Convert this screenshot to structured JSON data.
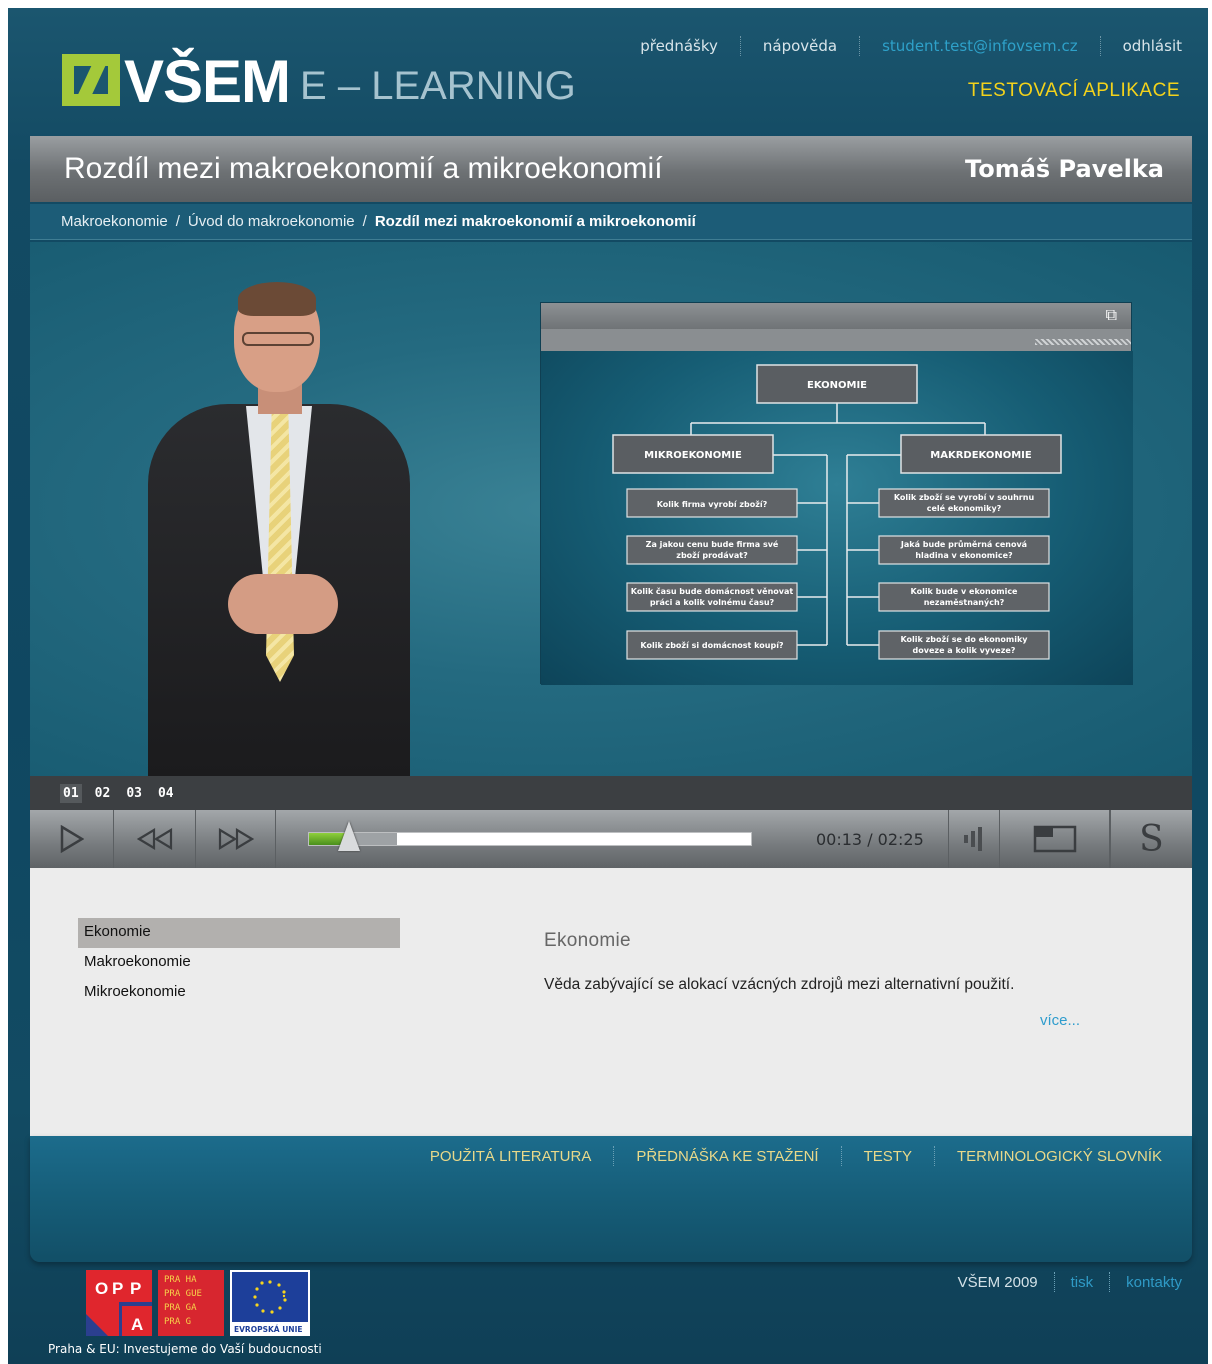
{
  "header": {
    "logo_text": "VŠEM",
    "logo_sub": "E – LEARNING",
    "nav": [
      "přednášky",
      "nápověda",
      "student.test@infovsem.cz",
      "odhlásit"
    ],
    "app_label": "TESTOVACÍ APLIKACE"
  },
  "lesson": {
    "title": "Rozdíl mezi makroekonomií a mikroekonomií",
    "author": "Tomáš Pavelka",
    "breadcrumb": [
      "Makroekonomie",
      "Úvod do makroekonomie",
      "Rozdíl mezi makroekonomií a mikroekonomií"
    ]
  },
  "slide": {
    "root": "EKONOMIE",
    "left_title": "MIKROEKONOMIE",
    "right_title": "MAKRDEKONOMIE",
    "left_items": [
      [
        "Kolik firma vyrobí zboží?"
      ],
      [
        "Za jakou cenu bude firma své",
        "zboží prodávat?"
      ],
      [
        "Kolik času bude domácnost věnovat",
        "práci a kolik volnému času?"
      ],
      [
        "Kolik zboží si domácnost koupí?"
      ]
    ],
    "right_items": [
      [
        "Kolik zboží se vyrobí v souhrnu",
        "celé ekonomiky?"
      ],
      [
        "Jaká bude průměrná cenová",
        "hladina v ekonomice?"
      ],
      [
        "Kolik bude v ekonomice",
        "nezaměstnaných?"
      ],
      [
        "Kolik zboží se do ekonomiky",
        "doveze a kolik vyveze?"
      ]
    ]
  },
  "player": {
    "chapters": [
      "01",
      "02",
      "03",
      "04"
    ],
    "active_chapter": "01",
    "time": "00:13 / 02:25",
    "progress": 0.09,
    "buffered": 0.2,
    "subtitle_glyph": "S",
    "icons": [
      "play-icon",
      "rewind-icon",
      "fast-forward-icon",
      "volume-icon",
      "fullscreen-icon",
      "subtitles-icon"
    ]
  },
  "glossary": {
    "terms": [
      "Ekonomie",
      "Makroekonomie",
      "Mikroekonomie"
    ],
    "active_term": "Ekonomie",
    "definition_title": "Ekonomie",
    "definition_text": "Věda zabývající se alokací vzácných zdrojů mezi alternativní použití.",
    "more_link": "více..."
  },
  "bottom_links": [
    "POUŽITÁ LITERATURA",
    "PŘEDNÁŠKA KE STAŽENÍ",
    "TESTY",
    "TERMINOLOGICKÝ SLOVNÍK"
  ],
  "footer": {
    "copyright": "VŠEM 2009",
    "links": [
      "tisk",
      "kontakty"
    ],
    "logo_labels": {
      "oppa": [
        "O",
        "P",
        "P",
        "A"
      ],
      "praha": [
        "PRA HA",
        "PRA GUE",
        "PRA GA",
        "PRA G"
      ],
      "eu": "EVROPSKÁ UNIE"
    },
    "tagline": "Praha & EU: Investujeme do Vaší budoucnosti"
  },
  "colors": {
    "accent_yellow": "#f3d21b",
    "link_blue": "#2e9ccd",
    "logo_green": "#a4c93a",
    "background": "#134a63"
  }
}
